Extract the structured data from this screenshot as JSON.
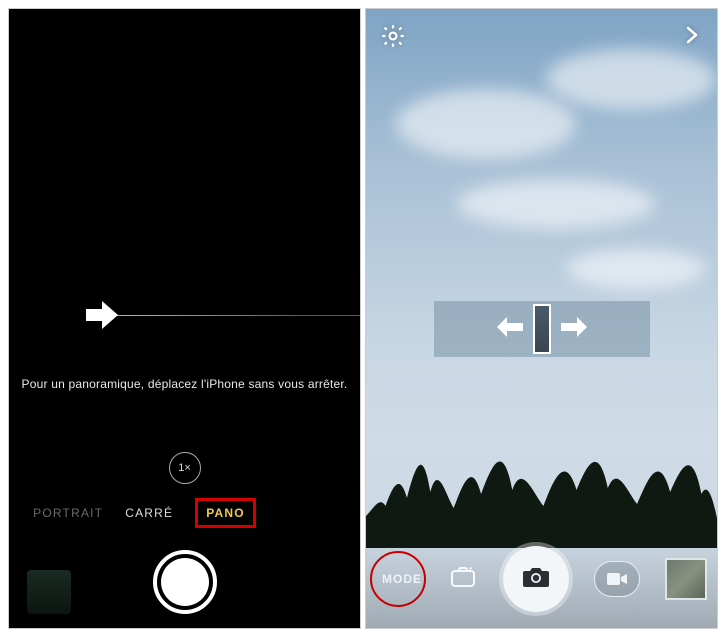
{
  "left": {
    "instruction": "Pour un panoramique, déplacez l'iPhone sans vous arrêter.",
    "zoom_label": "1×",
    "modes": {
      "faded": "PORTRAIT",
      "middle": "CARRÉ",
      "active": "PANO"
    }
  },
  "right": {
    "mode_button": "MODE"
  }
}
